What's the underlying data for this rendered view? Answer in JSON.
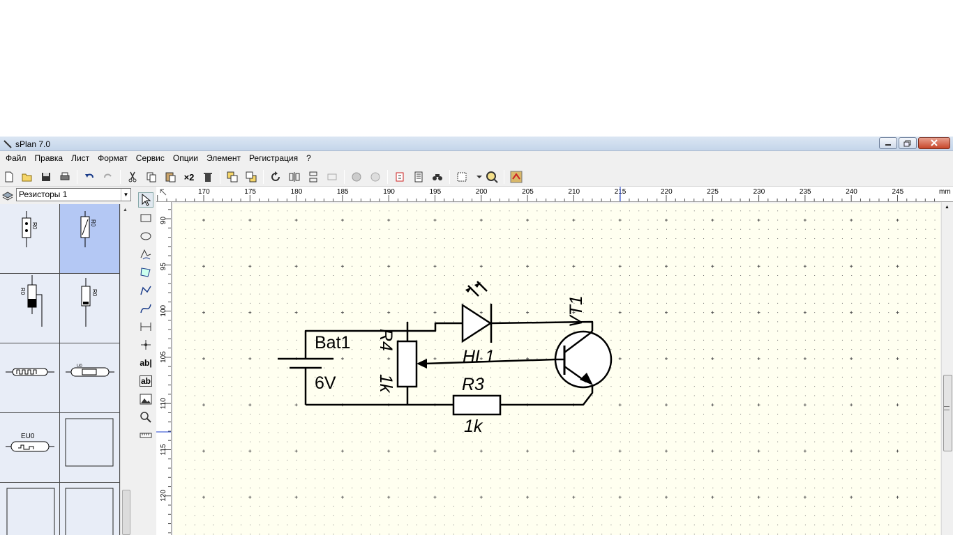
{
  "window": {
    "title": "sPlan 7.0"
  },
  "menu": [
    "Файл",
    "Правка",
    "Лист",
    "Формат",
    "Сервис",
    "Опции",
    "Элемент",
    "Регистрация",
    "?"
  ],
  "toolbar": {
    "duplicate_label": "×2"
  },
  "library": {
    "selected": "Резисторы 1",
    "cells": [
      {
        "label": "R0",
        "selected": false
      },
      {
        "label": "R0",
        "selected": true
      },
      {
        "label": "R0",
        "selected": false
      },
      {
        "label": "R0",
        "selected": false
      },
      {
        "label": "",
        "selected": false
      },
      {
        "label": "U0",
        "selected": false
      },
      {
        "label": "EU0",
        "selected": false
      },
      {
        "label": "",
        "selected": false
      },
      {
        "label": "",
        "selected": false
      },
      {
        "label": "",
        "selected": false
      }
    ]
  },
  "tools": {
    "text_tool_label": "ab|",
    "text_box_label": "ab"
  },
  "ruler": {
    "unit": "mm",
    "h_labels": [
      "170",
      "175",
      "180",
      "185",
      "190",
      "195",
      "200",
      "205",
      "210",
      "215",
      "220",
      "225",
      "230",
      "235",
      "240",
      "245"
    ],
    "v_labels": [
      "90",
      "95",
      "100",
      "105",
      "110",
      "115",
      "120"
    ]
  },
  "schematic": {
    "battery": {
      "name": "Bat1",
      "value": "6V"
    },
    "potentiometer": {
      "name": "R4",
      "value": "1k"
    },
    "led": {
      "name": "HL1"
    },
    "resistor": {
      "name": "R3",
      "value": "1k"
    },
    "transistor": {
      "name": "VT1"
    }
  }
}
